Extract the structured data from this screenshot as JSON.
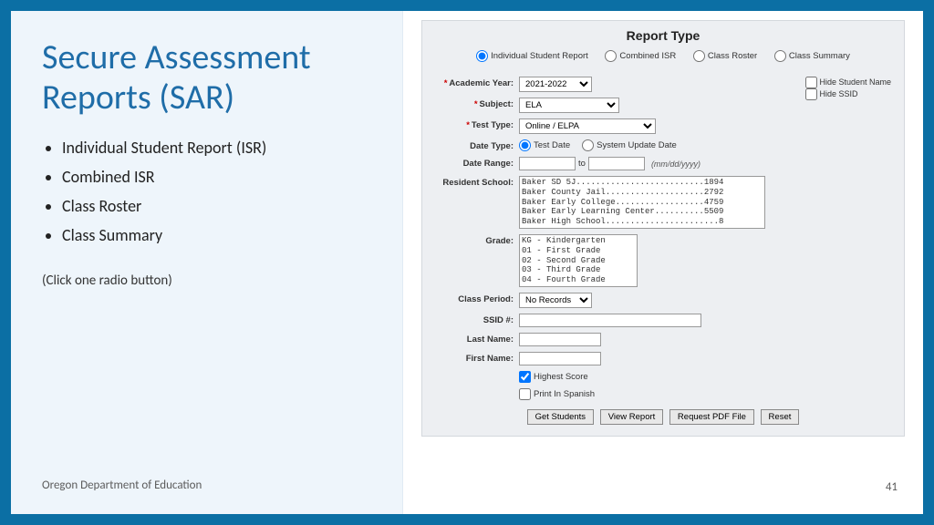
{
  "left": {
    "title": "Secure Assessment Reports (SAR)",
    "bullets": [
      "Individual Student Report (ISR)",
      "Combined ISR",
      "Class Roster",
      "Class Summary"
    ],
    "hint": "(Click one radio button)",
    "footer": "Oregon Department of Education",
    "page": "41"
  },
  "form": {
    "title": "Report Type",
    "radios": {
      "isr": "Individual Student Report",
      "combined": "Combined ISR",
      "roster": "Class Roster",
      "summary": "Class Summary"
    },
    "hide_name": "Hide Student Name",
    "hide_ssid": "Hide SSID",
    "labels": {
      "year": "Academic Year:",
      "subject": "Subject:",
      "testtype": "Test Type:",
      "datetype": "Date Type:",
      "daterange": "Date Range:",
      "to": "to",
      "datehint": "(mm/dd/yyyy)",
      "resident": "Resident School:",
      "grade": "Grade:",
      "classperiod": "Class Period:",
      "ssid": "SSID #:",
      "lastname": "Last Name:",
      "firstname": "First Name:"
    },
    "values": {
      "year": "2021-2022",
      "subject": "ELA",
      "testtype": "Online / ELPA",
      "classperiod": "No Records"
    },
    "datetype_opts": {
      "test": "Test Date",
      "system": "System Update Date"
    },
    "resident_list": "Baker SD 5J..........................1894\nBaker County Jail....................2792\nBaker Early College..................4759\nBaker Early Learning Center..........5509\nBaker High School.......................8",
    "grade_list": "KG - Kindergarten\n01 - First Grade\n02 - Second Grade\n03 - Third Grade\n04 - Fourth Grade",
    "check_highest": "Highest Score",
    "check_spanish": "Print In Spanish",
    "buttons": {
      "students": "Get Students",
      "view": "View Report",
      "pdf": "Request PDF File",
      "reset": "Reset"
    }
  }
}
